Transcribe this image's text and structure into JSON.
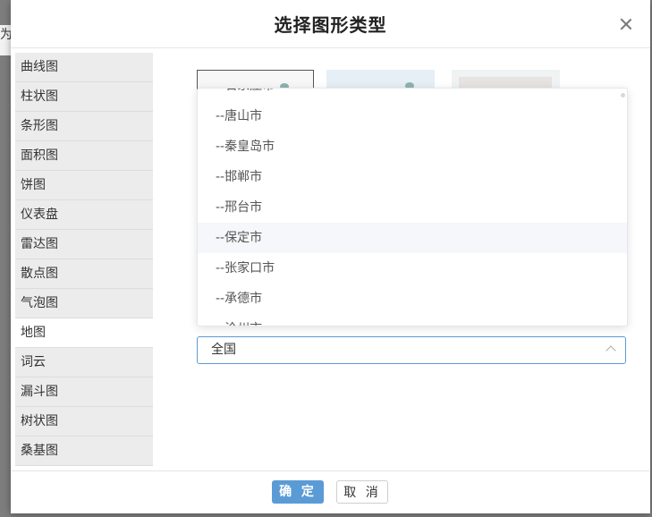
{
  "background": {
    "tab_fragment": "为"
  },
  "dialog": {
    "title": "选择图形类型",
    "footer": {
      "confirm_label": "确 定",
      "cancel_label": "取 消"
    }
  },
  "sidebar": {
    "active_index": 9,
    "items": [
      {
        "label": "曲线图"
      },
      {
        "label": "柱状图"
      },
      {
        "label": "条形图"
      },
      {
        "label": "面积图"
      },
      {
        "label": "饼图"
      },
      {
        "label": "仪表盘"
      },
      {
        "label": "雷达图"
      },
      {
        "label": "散点图"
      },
      {
        "label": "气泡图"
      },
      {
        "label": "地图"
      },
      {
        "label": "词云"
      },
      {
        "label": "漏斗图"
      },
      {
        "label": "树状图"
      },
      {
        "label": "桑基图"
      }
    ]
  },
  "region_select": {
    "value": "全国",
    "options": [
      {
        "label": "--石家庄市"
      },
      {
        "label": "--唐山市"
      },
      {
        "label": "--秦皇岛市"
      },
      {
        "label": "--邯郸市"
      },
      {
        "label": "--邢台市"
      },
      {
        "label": "--保定市",
        "hovered": true
      },
      {
        "label": "--张家口市"
      },
      {
        "label": "--承德市"
      },
      {
        "label": "--沧州市"
      }
    ]
  },
  "colors": {
    "accent": "#5b9bd5",
    "hover_bg": "#f5f7fa",
    "sidebar_bg": "#ececec"
  }
}
